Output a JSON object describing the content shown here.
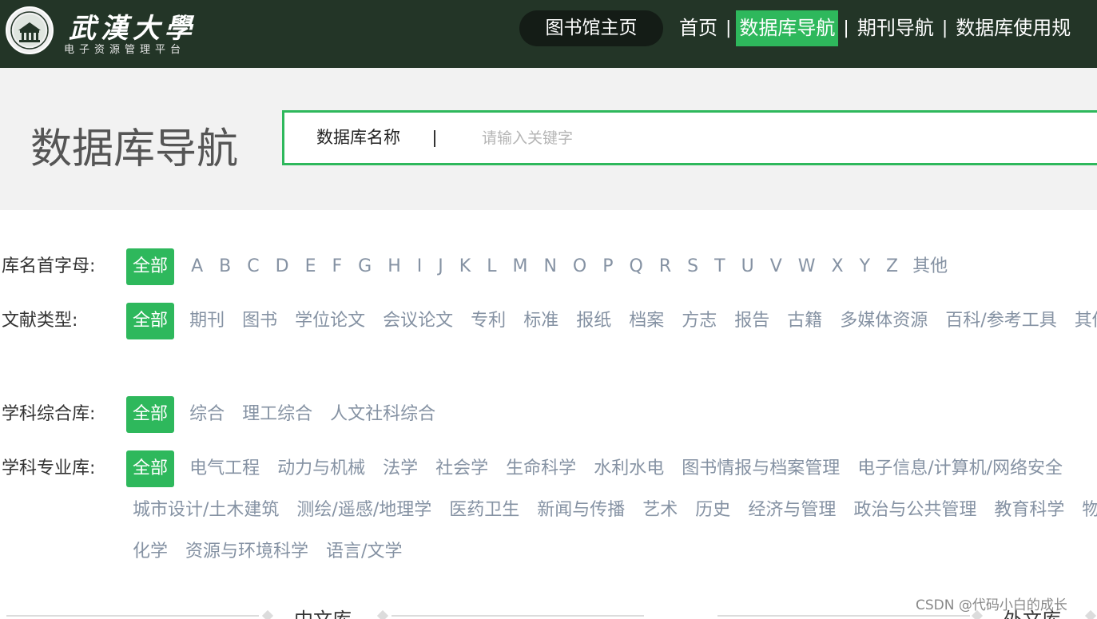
{
  "header": {
    "logo_title": "武漢大學",
    "logo_subtitle": "电子资源管理平台",
    "library_home": "图书馆主页",
    "nav": [
      {
        "label": "首页",
        "active": false
      },
      {
        "label": "数据库导航",
        "active": true
      },
      {
        "label": "期刊导航",
        "active": false
      },
      {
        "label": "数据库使用规",
        "active": false
      }
    ],
    "nav_separator": "|",
    "accent_color": "#2eb85c",
    "background_color": "#233527"
  },
  "banner": {
    "title": "数据库导航",
    "search": {
      "field_label": "数据库名称",
      "placeholder": "请输入关键字",
      "value": ""
    }
  },
  "filters": {
    "initials": {
      "label": "库名首字母:",
      "all": "全部",
      "options": [
        "A",
        "B",
        "C",
        "D",
        "E",
        "F",
        "G",
        "H",
        "I",
        "J",
        "K",
        "L",
        "M",
        "N",
        "O",
        "P",
        "Q",
        "R",
        "S",
        "T",
        "U",
        "V",
        "W",
        "X",
        "Y",
        "Z",
        "其他"
      ]
    },
    "doc_types": {
      "label": "文献类型:",
      "all": "全部",
      "options": [
        "期刊",
        "图书",
        "学位论文",
        "会议论文",
        "专利",
        "标准",
        "报纸",
        "档案",
        "方志",
        "报告",
        "古籍",
        "多媒体资源",
        "百科/参考工具",
        "其他"
      ]
    },
    "comprehensive": {
      "label": "学科综合库:",
      "all": "全部",
      "options": [
        "综合",
        "理工综合",
        "人文社科综合"
      ]
    },
    "specialized": {
      "label": "学科专业库:",
      "all": "全部",
      "options": [
        "电气工程",
        "动力与机械",
        "法学",
        "社会学",
        "生命科学",
        "水利水电",
        "图书情报与档案管理",
        "电子信息/计算机/网络安全",
        "城市设计/土木建筑",
        "测绘/遥感/地理学",
        "医药卫生",
        "新闻与传播",
        "艺术",
        "历史",
        "经济与管理",
        "政治与公共管理",
        "教育科学",
        "物理",
        "化学",
        "资源与环境科学",
        "语言/文学"
      ]
    }
  },
  "tabs": [
    "中文库",
    "外文库"
  ],
  "watermark": "CSDN @代码小白的成长"
}
